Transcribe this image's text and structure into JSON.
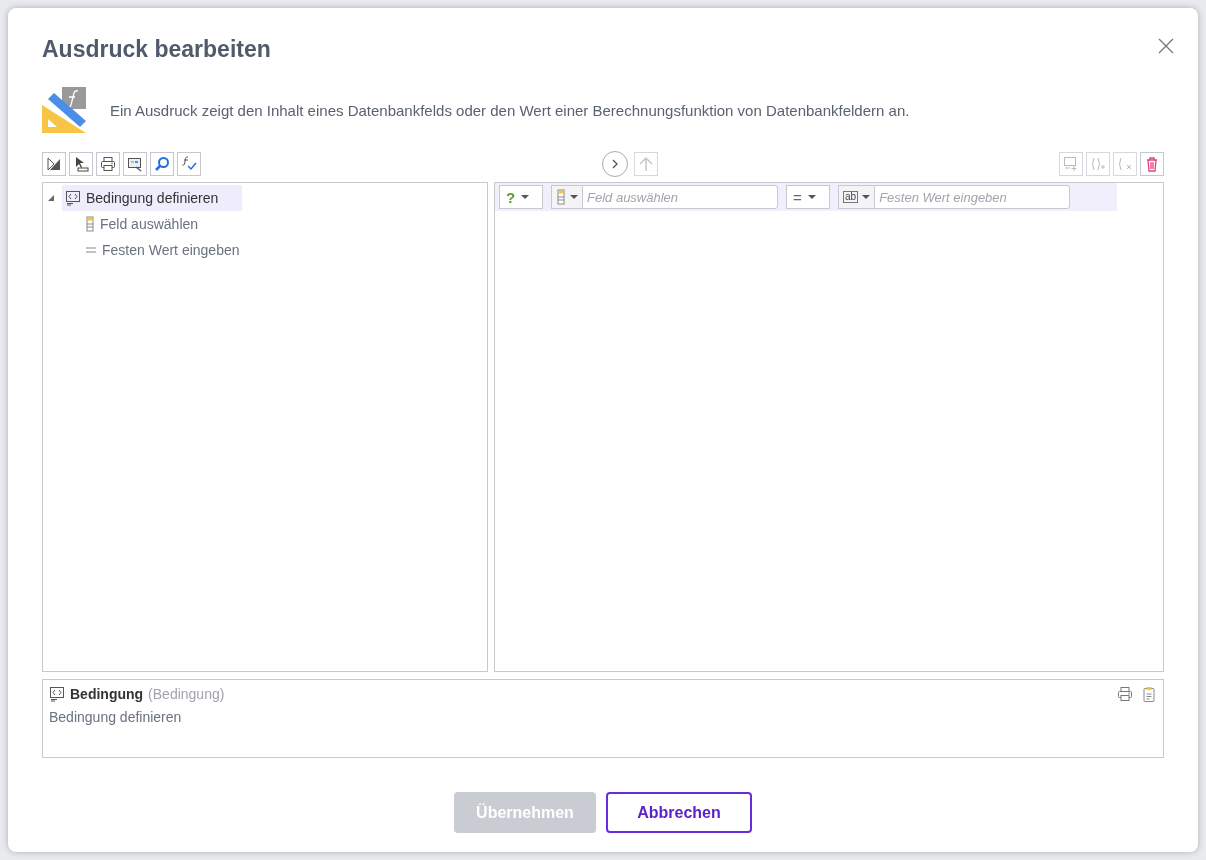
{
  "dialog": {
    "title": "Ausdruck bearbeiten",
    "description": "Ein Ausdruck zeigt den Inhalt eines Datenbankfelds oder den Wert einer Berechnungsfunktion von Datenbankfeldern an."
  },
  "tree": [
    {
      "label": "Bedingung definieren",
      "kind": "condition",
      "expanded": true,
      "selected": true,
      "children": [
        {
          "label": "Feld auswählen",
          "kind": "field",
          "selected": false
        },
        {
          "label": "Festen Wert eingeben",
          "kind": "equals",
          "selected": false
        }
      ]
    }
  ],
  "condition_row": {
    "type_symbol": "?",
    "field_placeholder": "Feld auswählen",
    "operator": "=",
    "value_type": "ab",
    "value_placeholder": "Festen Wert eingeben"
  },
  "info": {
    "title": "Bedingung",
    "type": "(Bedingung)",
    "description": "Bedingung definieren"
  },
  "buttons": [
    {
      "label": "Übernehmen",
      "kind": "primary",
      "disabled": true
    },
    {
      "label": "Abbrechen",
      "kind": "secondary",
      "disabled": false
    }
  ]
}
